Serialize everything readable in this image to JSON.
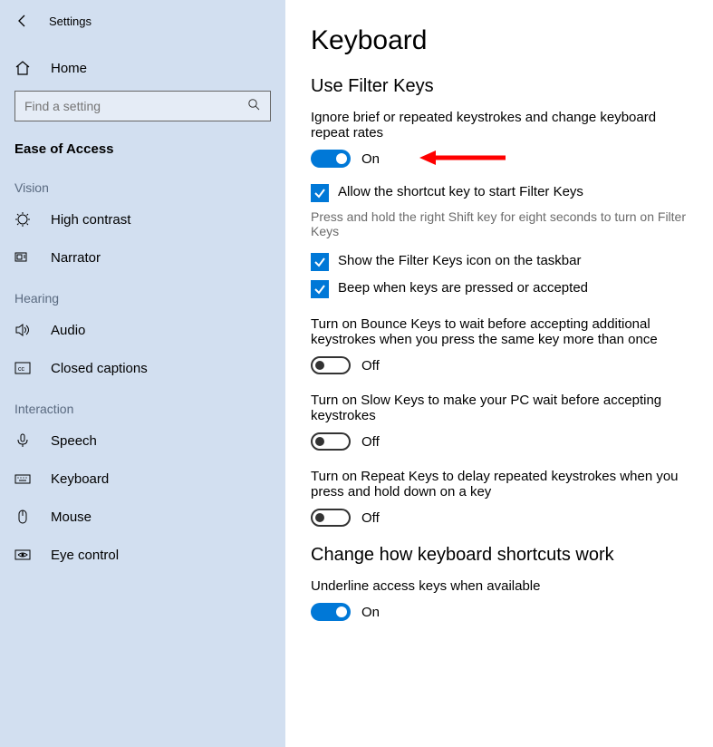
{
  "window": {
    "title": "Settings"
  },
  "sidebar": {
    "home": "Home",
    "search_placeholder": "Find a setting",
    "section": "Ease of Access",
    "groups": [
      {
        "label": "Vision",
        "items": [
          "High contrast",
          "Narrator"
        ]
      },
      {
        "label": "Hearing",
        "items": [
          "Audio",
          "Closed captions"
        ]
      },
      {
        "label": "Interaction",
        "items": [
          "Speech",
          "Keyboard",
          "Mouse",
          "Eye control"
        ]
      }
    ]
  },
  "main": {
    "title": "Keyboard",
    "filter": {
      "heading": "Use Filter Keys",
      "desc": "Ignore brief or repeated keystrokes and change keyboard repeat rates",
      "toggle": {
        "on": true,
        "label": "On"
      },
      "shortcut": {
        "checked": true,
        "label": "Allow the shortcut key to start Filter Keys",
        "hint": "Press and hold the right Shift key for eight seconds to turn on Filter Keys"
      },
      "taskbar": {
        "checked": true,
        "label": "Show the Filter Keys icon on the taskbar"
      },
      "beep": {
        "checked": true,
        "label": "Beep when keys are pressed or accepted"
      },
      "bounce": {
        "desc": "Turn on Bounce Keys to wait before accepting additional keystrokes when you press the same key more than once",
        "on": false,
        "label": "Off"
      },
      "slow": {
        "desc": "Turn on Slow Keys to make your PC wait before accepting keystrokes",
        "on": false,
        "label": "Off"
      },
      "repeat": {
        "desc": "Turn on Repeat Keys to delay repeated keystrokes when you press and hold down on a key",
        "on": false,
        "label": "Off"
      }
    },
    "shortcuts": {
      "heading": "Change how keyboard shortcuts work",
      "underline": {
        "desc": "Underline access keys when available",
        "on": true,
        "label": "On"
      }
    }
  }
}
